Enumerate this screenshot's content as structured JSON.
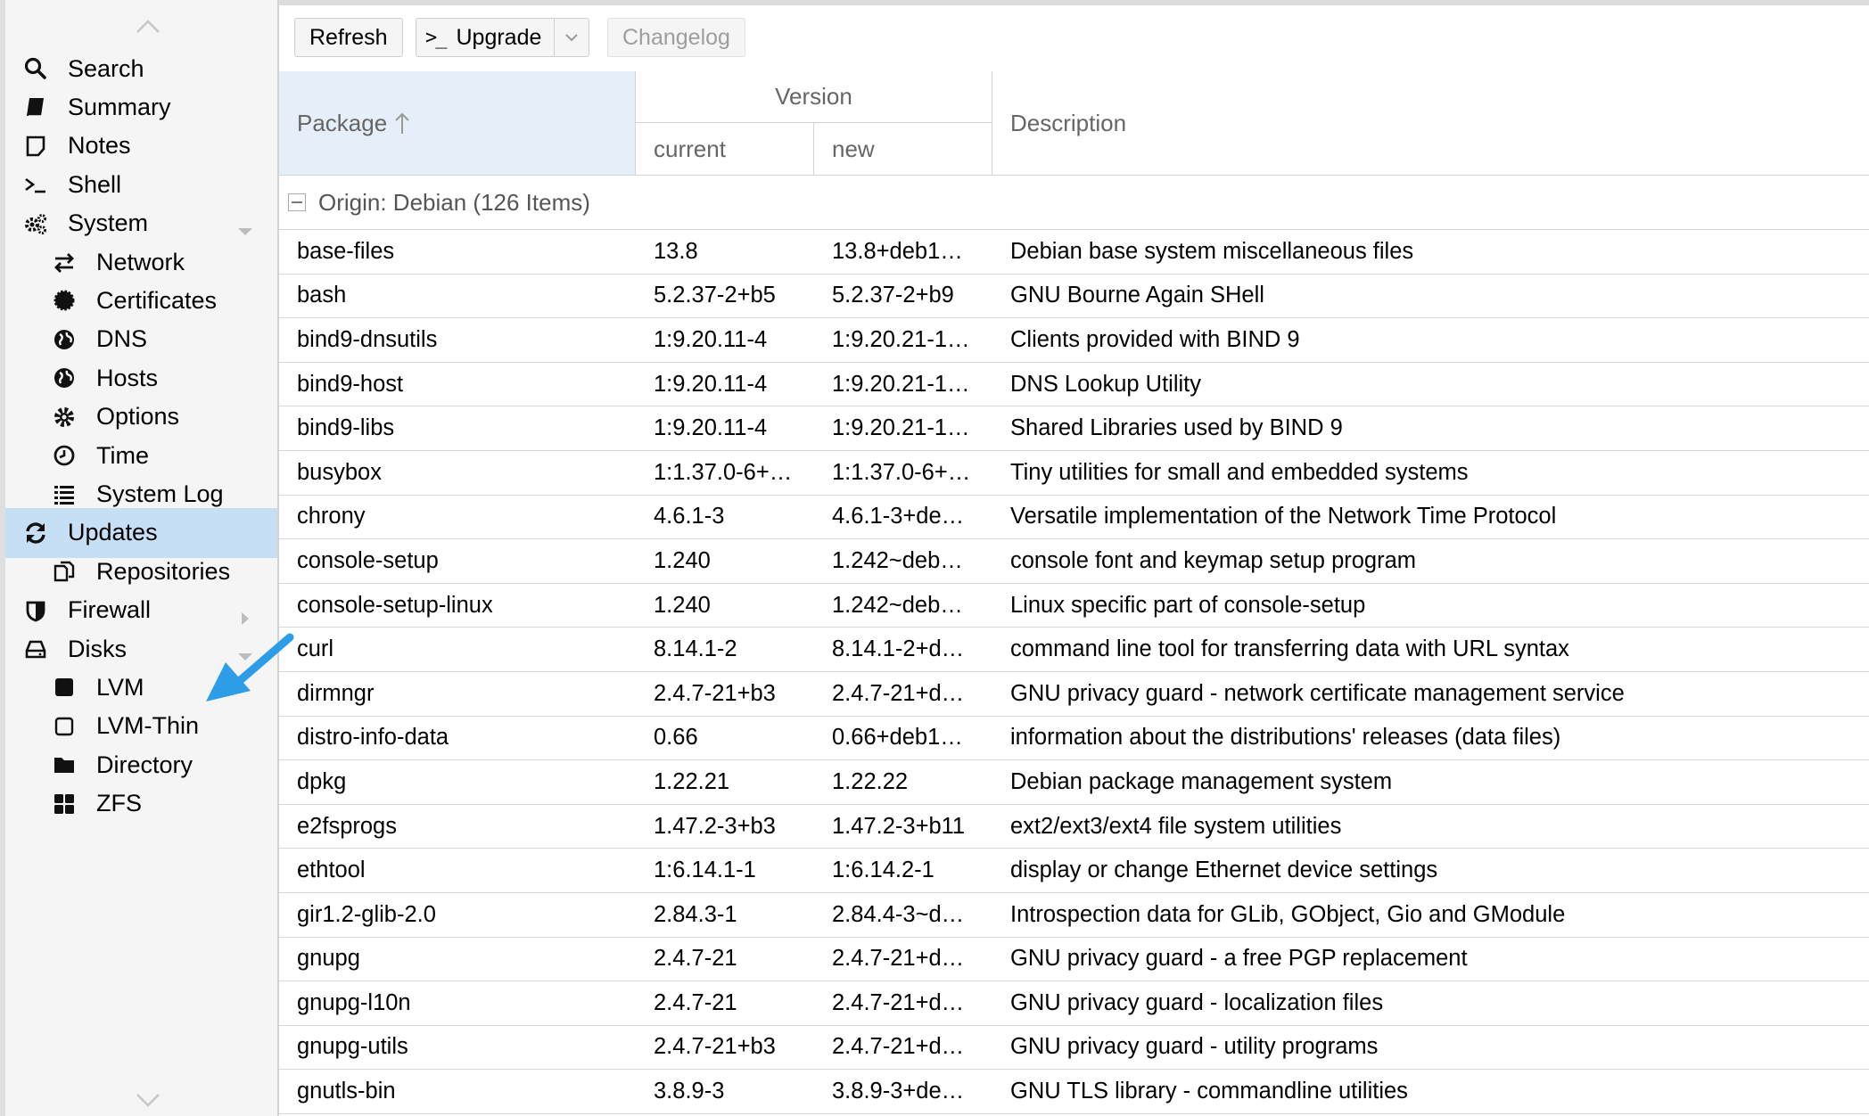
{
  "sidebar": {
    "items": [
      {
        "label": "Search",
        "icon": "search-icon",
        "sub": false,
        "selected": false
      },
      {
        "label": "Summary",
        "icon": "book-icon",
        "sub": false,
        "selected": false
      },
      {
        "label": "Notes",
        "icon": "note-icon",
        "sub": false,
        "selected": false
      },
      {
        "label": "Shell",
        "icon": "terminal-icon",
        "sub": false,
        "selected": false
      },
      {
        "label": "System",
        "icon": "cogs-icon",
        "sub": false,
        "selected": false,
        "expander": "down"
      },
      {
        "label": "Network",
        "icon": "exchange-icon",
        "sub": true,
        "selected": false
      },
      {
        "label": "Certificates",
        "icon": "certificate-icon",
        "sub": true,
        "selected": false
      },
      {
        "label": "DNS",
        "icon": "globe-icon",
        "sub": true,
        "selected": false
      },
      {
        "label": "Hosts",
        "icon": "globe-icon",
        "sub": true,
        "selected": false
      },
      {
        "label": "Options",
        "icon": "gear-icon",
        "sub": true,
        "selected": false
      },
      {
        "label": "Time",
        "icon": "clock-icon",
        "sub": true,
        "selected": false
      },
      {
        "label": "System Log",
        "icon": "list-icon",
        "sub": true,
        "selected": false
      },
      {
        "label": "Updates",
        "icon": "refresh-icon",
        "sub": false,
        "selected": true
      },
      {
        "label": "Repositories",
        "icon": "files-icon",
        "sub": true,
        "selected": false
      },
      {
        "label": "Firewall",
        "icon": "shield-icon",
        "sub": false,
        "selected": false,
        "expander": "right"
      },
      {
        "label": "Disks",
        "icon": "hdd-icon",
        "sub": false,
        "selected": false,
        "expander": "down"
      },
      {
        "label": "LVM",
        "icon": "square-filled-icon",
        "sub": true,
        "selected": false
      },
      {
        "label": "LVM-Thin",
        "icon": "square-outline-icon",
        "sub": true,
        "selected": false
      },
      {
        "label": "Directory",
        "icon": "folder-icon",
        "sub": true,
        "selected": false
      },
      {
        "label": "ZFS",
        "icon": "grid-icon",
        "sub": true,
        "selected": false
      }
    ]
  },
  "toolbar": {
    "refresh_label": "Refresh",
    "upgrade_label": "Upgrade",
    "changelog_label": "Changelog"
  },
  "grid": {
    "header": {
      "package": "Package",
      "version": "Version",
      "current": "current",
      "new": "new",
      "description": "Description"
    },
    "group_label": "Origin: Debian (126 Items)",
    "rows": [
      {
        "package": "base-files",
        "current": "13.8",
        "new": "13.8+deb1…",
        "description": "Debian base system miscellaneous files"
      },
      {
        "package": "bash",
        "current": "5.2.37-2+b5",
        "new": "5.2.37-2+b9",
        "description": "GNU Bourne Again SHell"
      },
      {
        "package": "bind9-dnsutils",
        "current": "1:9.20.11-4",
        "new": "1:9.20.21-1…",
        "description": "Clients provided with BIND 9"
      },
      {
        "package": "bind9-host",
        "current": "1:9.20.11-4",
        "new": "1:9.20.21-1…",
        "description": "DNS Lookup Utility"
      },
      {
        "package": "bind9-libs",
        "current": "1:9.20.11-4",
        "new": "1:9.20.21-1…",
        "description": "Shared Libraries used by BIND 9"
      },
      {
        "package": "busybox",
        "current": "1:1.37.0-6+…",
        "new": "1:1.37.0-6+…",
        "description": "Tiny utilities for small and embedded systems"
      },
      {
        "package": "chrony",
        "current": "4.6.1-3",
        "new": "4.6.1-3+de…",
        "description": "Versatile implementation of the Network Time Protocol"
      },
      {
        "package": "console-setup",
        "current": "1.240",
        "new": "1.242~deb…",
        "description": "console font and keymap setup program"
      },
      {
        "package": "console-setup-linux",
        "current": "1.240",
        "new": "1.242~deb…",
        "description": "Linux specific part of console-setup"
      },
      {
        "package": "curl",
        "current": "8.14.1-2",
        "new": "8.14.1-2+d…",
        "description": "command line tool for transferring data with URL syntax"
      },
      {
        "package": "dirmngr",
        "current": "2.4.7-21+b3",
        "new": "2.4.7-21+d…",
        "description": "GNU privacy guard - network certificate management service"
      },
      {
        "package": "distro-info-data",
        "current": "0.66",
        "new": "0.66+deb1…",
        "description": "information about the distributions' releases (data files)"
      },
      {
        "package": "dpkg",
        "current": "1.22.21",
        "new": "1.22.22",
        "description": "Debian package management system"
      },
      {
        "package": "e2fsprogs",
        "current": "1.47.2-3+b3",
        "new": "1.47.2-3+b11",
        "description": "ext2/ext3/ext4 file system utilities"
      },
      {
        "package": "ethtool",
        "current": "1:6.14.1-1",
        "new": "1:6.14.2-1",
        "description": "display or change Ethernet device settings"
      },
      {
        "package": "gir1.2-glib-2.0",
        "current": "2.84.3-1",
        "new": "2.84.4-3~d…",
        "description": "Introspection data for GLib, GObject, Gio and GModule"
      },
      {
        "package": "gnupg",
        "current": "2.4.7-21",
        "new": "2.4.7-21+d…",
        "description": "GNU privacy guard - a free PGP replacement"
      },
      {
        "package": "gnupg-l10n",
        "current": "2.4.7-21",
        "new": "2.4.7-21+d…",
        "description": "GNU privacy guard - localization files"
      },
      {
        "package": "gnupg-utils",
        "current": "2.4.7-21+b3",
        "new": "2.4.7-21+d…",
        "description": "GNU privacy guard - utility programs"
      },
      {
        "package": "gnutls-bin",
        "current": "3.8.9-3",
        "new": "3.8.9-3+de…",
        "description": "GNU TLS library - commandline utilities"
      }
    ]
  },
  "colors": {
    "selected_bg": "#c7dff5",
    "header_sorted_bg": "#e6eef9",
    "annotation_arrow": "#2e9de8"
  }
}
